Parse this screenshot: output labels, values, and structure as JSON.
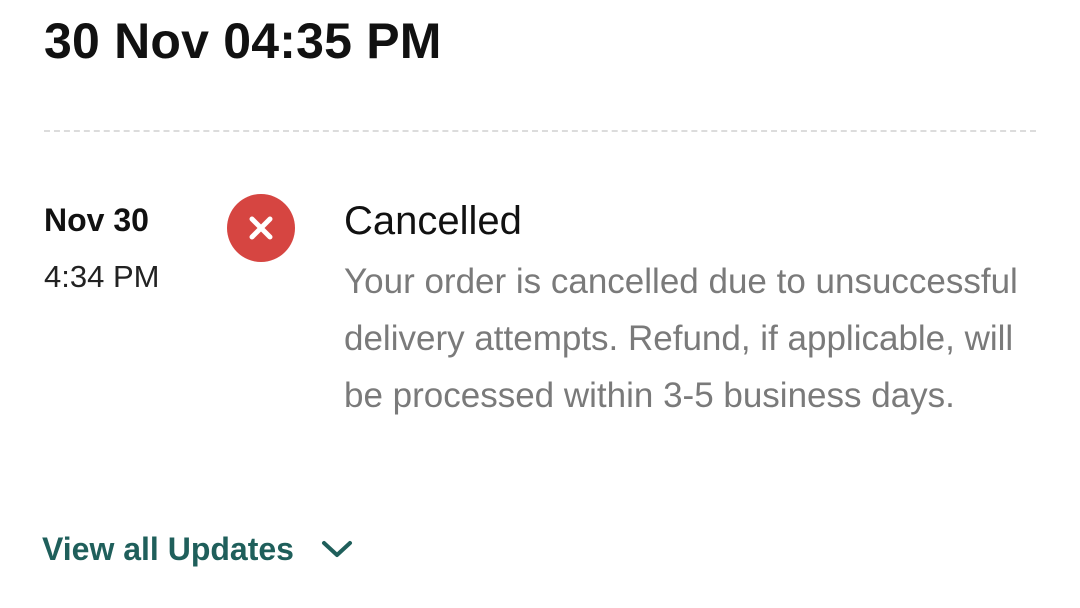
{
  "header": {
    "datetime": "30 Nov 04:35 PM"
  },
  "timeline": {
    "entry": {
      "date": "Nov 30",
      "time": "4:34 PM",
      "status_icon": "close-x-icon",
      "status_color": "#d64541",
      "title": "Cancelled",
      "description": "Your order is cancelled due to unsuccessful delivery attempts. Refund, if applicable, will be processed within 3-5 business days."
    }
  },
  "footer": {
    "view_all_label": "View all Updates",
    "view_all_icon": "chevron-down-icon",
    "accent_color": "#1f5f5b"
  }
}
